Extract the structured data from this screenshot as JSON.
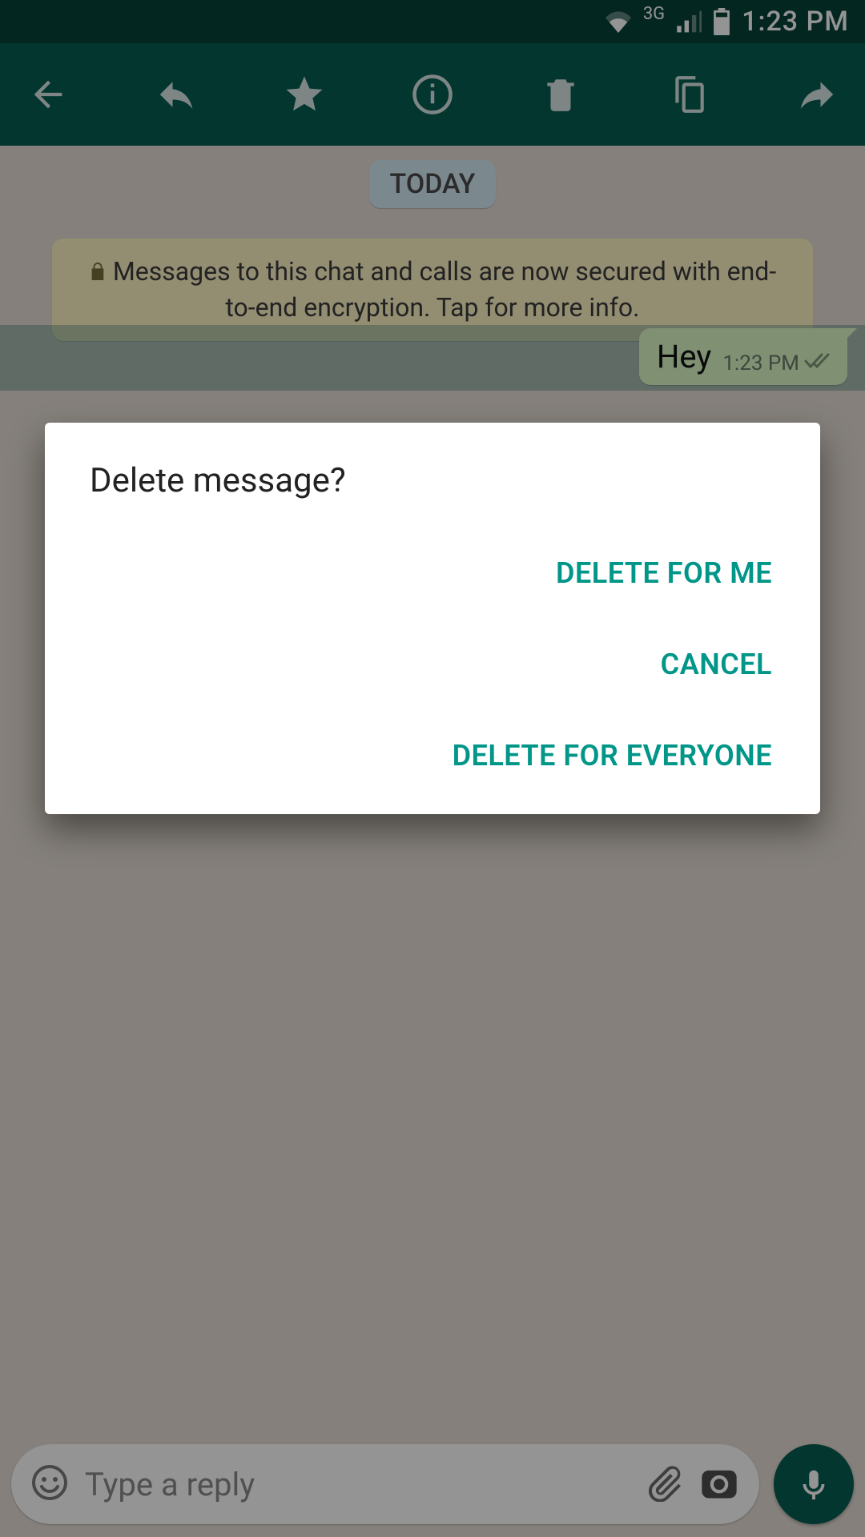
{
  "statusbar": {
    "network": "3G",
    "time": "1:23 PM"
  },
  "chat": {
    "date_label": "TODAY",
    "encryption_notice": "Messages to this chat and calls are now secured with end-to-end encryption. Tap for more info.",
    "messages": [
      {
        "text": "Hey",
        "time": "1:23 PM",
        "outgoing": true,
        "status": "read"
      }
    ]
  },
  "composer": {
    "placeholder": "Type a reply"
  },
  "dialog": {
    "title": "Delete message?",
    "actions": {
      "delete_for_me": "DELETE FOR ME",
      "cancel": "CANCEL",
      "delete_for_everyone": "DELETE FOR EVERYONE"
    }
  }
}
